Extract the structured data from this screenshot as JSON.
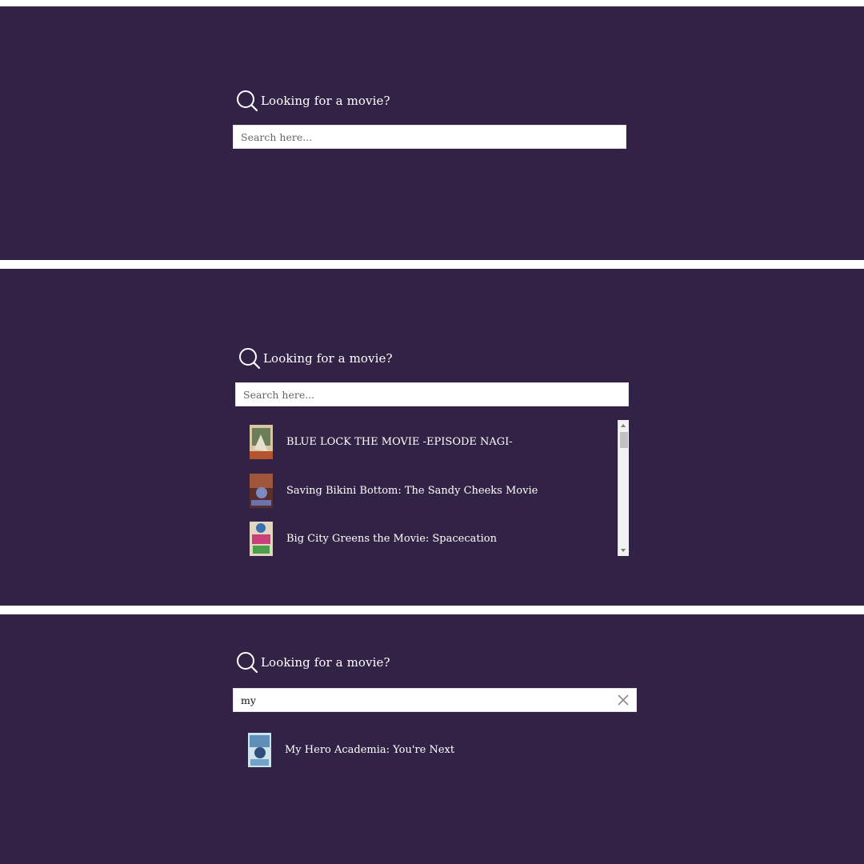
{
  "heading_text": "Looking for a movie?",
  "icons": {
    "search": "search-icon",
    "clear": "close-icon"
  },
  "colors": {
    "panel_bg": "#322346",
    "text": "#ffffff",
    "input_bg": "#ffffff"
  },
  "state_empty": {
    "search": {
      "placeholder": "Search here...",
      "value": ""
    }
  },
  "state_results": {
    "search": {
      "placeholder": "Search here...",
      "value": ""
    },
    "results": [
      {
        "title": "BLUE LOCK THE MOVIE -EPISODE NAGI-"
      },
      {
        "title": "Saving Bikini Bottom: The Sandy Cheeks Movie"
      },
      {
        "title": "Big City Greens the Movie: Spacecation"
      }
    ]
  },
  "state_query": {
    "search": {
      "placeholder": "Search here...",
      "value": "my"
    },
    "results": [
      {
        "title": "My Hero Academia: You're Next"
      }
    ]
  }
}
